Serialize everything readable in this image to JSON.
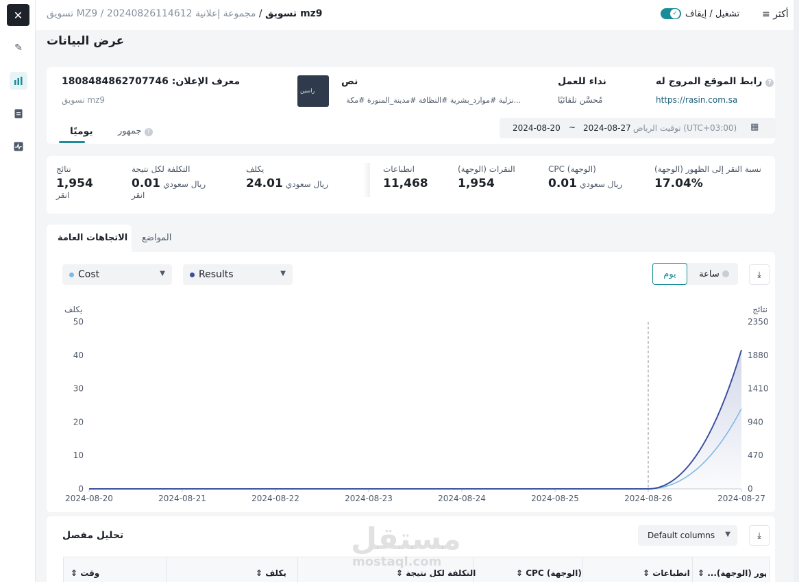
{
  "rail": {
    "close": "✕"
  },
  "topbar": {
    "crumb_current": "mz9 تسويق",
    "crumb_sep": " / ",
    "crumb_parent": "مجموعة إعلانية 20240826114612 / MZ9 تسويق",
    "toggle_label": "تشغيل / إيقاف",
    "more_label": "أكثر"
  },
  "page_title": "عرض البيانات",
  "ad_info": {
    "ad_id_label": "معرف الإعلان:",
    "ad_id_value": "1808484862707746",
    "ad_name": "mz9 تسويق",
    "text_label": "نص",
    "text_value": "...نزلية #موارد_بشرية #النظافة #مدينة_المنورة #مكة",
    "cta_label": "نداء للعمل",
    "cta_value": "مُحسَّن تلقائيًا",
    "url_label": "رابط الموقع المروج له",
    "url_value": "https://rasin.com.sa",
    "thumb_text": "راسين"
  },
  "tabs_top": {
    "daily": "يوميًا",
    "audience": "جمهور"
  },
  "date_range": {
    "timezone": "توقيت الرياض (UTC+03:00)",
    "start": "2024-08-20",
    "end": "2024-08-27",
    "sep": "~"
  },
  "metrics": [
    {
      "label": "نتائج",
      "value": "1,954",
      "unit": "انقر"
    },
    {
      "label": "التكلفة لكل نتيجة",
      "value": "0.01",
      "unit": "ريال سعودي",
      "unit2": "انقر"
    },
    {
      "label": "يكلف",
      "value": "24.01",
      "unit": "ريال سعودي"
    },
    {
      "label": "انطباعات",
      "value": "11,468"
    },
    {
      "label": "النقرات (الوجهة)",
      "value": "1,954"
    },
    {
      "label": "CPC (الوجهة)",
      "value": "0.01",
      "unit": "ريال سعودي"
    },
    {
      "label": "نسبة النقر إلى الظهور (الوجهة)",
      "value": "17.04%"
    }
  ],
  "section_tabs": {
    "trends": "الاتجاهات العامة",
    "placements": "المواضع"
  },
  "selects": {
    "cost": "Cost",
    "results": "Results"
  },
  "granularity": {
    "day": "يوم",
    "hour": "ساعة"
  },
  "colors": {
    "accent": "#1a8c9a",
    "cost_series": "#7cb9e8",
    "results_series": "#3a4f9c"
  },
  "chart_data": {
    "type": "line",
    "x": [
      "2024-08-20",
      "2024-08-21",
      "2024-08-22",
      "2024-08-23",
      "2024-08-24",
      "2024-08-25",
      "2024-08-26",
      "2024-08-27"
    ],
    "series": [
      {
        "name": "Cost",
        "axis": "left",
        "values": [
          0,
          0,
          0,
          0,
          0,
          0,
          0,
          24
        ]
      },
      {
        "name": "Results",
        "axis": "right",
        "values": [
          0,
          0,
          0,
          0,
          0,
          0,
          0,
          1954
        ]
      }
    ],
    "ylabel_left": "يكلف",
    "ylabel_right": "نتائج",
    "ylim_left": [
      0,
      50
    ],
    "ylim_right": [
      0,
      2350
    ],
    "yticks_left": [
      "50",
      "40",
      "30",
      "20",
      "10",
      "0"
    ],
    "yticks_right": [
      "2350",
      "1880",
      "1410",
      "940",
      "470",
      "0"
    ],
    "marker_x": "2024-08-26"
  },
  "detail": {
    "title": "تحليل مفصل",
    "columns_select": "Default columns",
    "headers": [
      "وقت",
      "يكلف",
      "التكلفة لكل نتيجة",
      "CPC (الوجهة)",
      "انطباعات",
      "...الظهور (الوجهة)"
    ]
  },
  "watermark": {
    "ar": "مستقل",
    "en": "mostaql.com"
  }
}
